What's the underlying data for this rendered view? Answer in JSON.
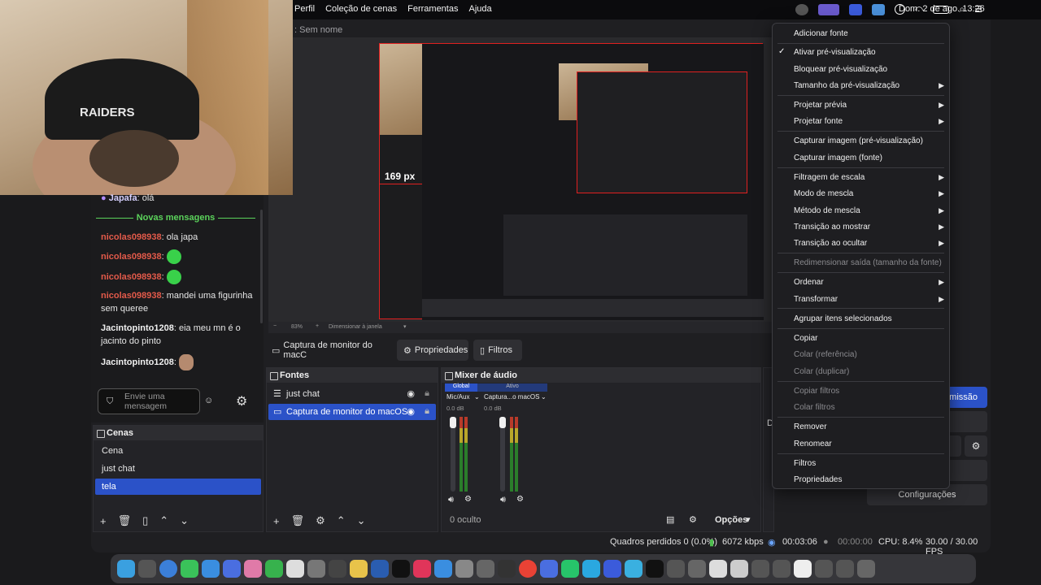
{
  "menubar": {
    "items": [
      "Perfil",
      "Coleção de cenas",
      "Ferramentas",
      "Ajuda"
    ],
    "clock": "Dom. 2 de ago.  13:26"
  },
  "preview": {
    "title": ": Sem nome",
    "label_px": "169 px",
    "zoom": "83%",
    "zoom_mode": "Dimensionar à janela"
  },
  "chat": {
    "top_user": "Japafa",
    "top_msg": "olá",
    "new_messages_label": "Novas mensagens",
    "messages": [
      {
        "user": "nicolas098938",
        "text": "ola japa"
      },
      {
        "user": "nicolas098938",
        "text": ""
      },
      {
        "user": "nicolas098938",
        "text": ""
      },
      {
        "user": "nicolas098938",
        "text": "mandei uma figurinha sem queree"
      },
      {
        "user": "Jacintopinto1208",
        "text": "eia meu mn é o jacinto do pinto"
      },
      {
        "user": "Jacintopinto1208",
        "text": ""
      }
    ],
    "input_placeholder": "Envie uma mensagem"
  },
  "source_toolbar": {
    "source_name": "Captura de monitor do macC",
    "properties": "Propriedades",
    "filters": "Filtros"
  },
  "scenes": {
    "title": "Cenas",
    "items": [
      "Cena",
      "just chat",
      "tela"
    ],
    "selected_index": 2
  },
  "sources": {
    "title": "Fontes",
    "items": [
      "just chat",
      "Captura de monitor do macOS"
    ],
    "selected_index": 1
  },
  "mixer": {
    "title": "Mixer de áudio",
    "tab_global": "Global",
    "tab_active": "Ativo",
    "channels": [
      {
        "name": "Mic/Aux",
        "db": "0.0 dB"
      },
      {
        "name": "Captura...o macOS",
        "db": "0.0 dB"
      }
    ],
    "hidden_label": "0 oculto",
    "options": "Opções"
  },
  "controls": {
    "start_streaming": "missão",
    "settings": "Configurações",
    "side_letter": "D"
  },
  "status": {
    "dropped": "Quadros perdidos 0 (0.0%)",
    "kbps": "6072 kbps",
    "stream_time": "00:03:06",
    "rec_time": "00:00:00",
    "cpu": "CPU: 8.4%",
    "fps": "30.00 / 30.00 FPS"
  },
  "context_menu": {
    "items": [
      {
        "label": "Adicionar fonte",
        "disabled": false,
        "submenu": false,
        "checked": false
      },
      {
        "label": "Ativar pré-visualização",
        "disabled": false,
        "submenu": false,
        "checked": true
      },
      {
        "label": "Bloquear pré-visualização",
        "disabled": false,
        "submenu": false,
        "checked": false
      },
      {
        "label": "Tamanho da pré-visualização",
        "disabled": false,
        "submenu": true,
        "checked": false
      },
      {
        "label": "Projetar prévia",
        "disabled": false,
        "submenu": true,
        "checked": false
      },
      {
        "label": "Projetar fonte",
        "disabled": false,
        "submenu": true,
        "checked": false
      },
      {
        "label": "Capturar imagem (pré-visualização)",
        "disabled": false,
        "submenu": false,
        "checked": false
      },
      {
        "label": "Capturar imagem (fonte)",
        "disabled": false,
        "submenu": false,
        "checked": false
      },
      {
        "label": "Filtragem de escala",
        "disabled": false,
        "submenu": true,
        "checked": false
      },
      {
        "label": "Modo de mescla",
        "disabled": false,
        "submenu": true,
        "checked": false
      },
      {
        "label": "Método de mescla",
        "disabled": false,
        "submenu": true,
        "checked": false
      },
      {
        "label": "Transição ao mostrar",
        "disabled": false,
        "submenu": true,
        "checked": false
      },
      {
        "label": "Transição ao ocultar",
        "disabled": false,
        "submenu": true,
        "checked": false
      },
      {
        "label": "Redimensionar saída (tamanho da fonte)",
        "disabled": true,
        "submenu": false,
        "checked": false
      },
      {
        "label": "Ordenar",
        "disabled": false,
        "submenu": true,
        "checked": false
      },
      {
        "label": "Transformar",
        "disabled": false,
        "submenu": true,
        "checked": false
      },
      {
        "label": "Agrupar itens selecionados",
        "disabled": false,
        "submenu": false,
        "checked": false
      },
      {
        "label": "Copiar",
        "disabled": false,
        "submenu": false,
        "checked": false
      },
      {
        "label": "Colar (referência)",
        "disabled": true,
        "submenu": false,
        "checked": false
      },
      {
        "label": "Colar (duplicar)",
        "disabled": true,
        "submenu": false,
        "checked": false
      },
      {
        "label": "Copiar filtros",
        "disabled": true,
        "submenu": false,
        "checked": false
      },
      {
        "label": "Colar filtros",
        "disabled": true,
        "submenu": false,
        "checked": false
      },
      {
        "label": "Remover",
        "disabled": false,
        "submenu": false,
        "checked": false
      },
      {
        "label": "Renomear",
        "disabled": false,
        "submenu": false,
        "checked": false
      },
      {
        "label": "Filtros",
        "disabled": false,
        "submenu": false,
        "checked": false
      },
      {
        "label": "Propriedades",
        "disabled": false,
        "submenu": false,
        "checked": false
      }
    ]
  },
  "webcam": {
    "cap_text": "RAIDERS"
  },
  "colors": {
    "accent": "#2b52c8",
    "red_outline": "#e02020",
    "new_msg_green": "#5bd35b"
  }
}
